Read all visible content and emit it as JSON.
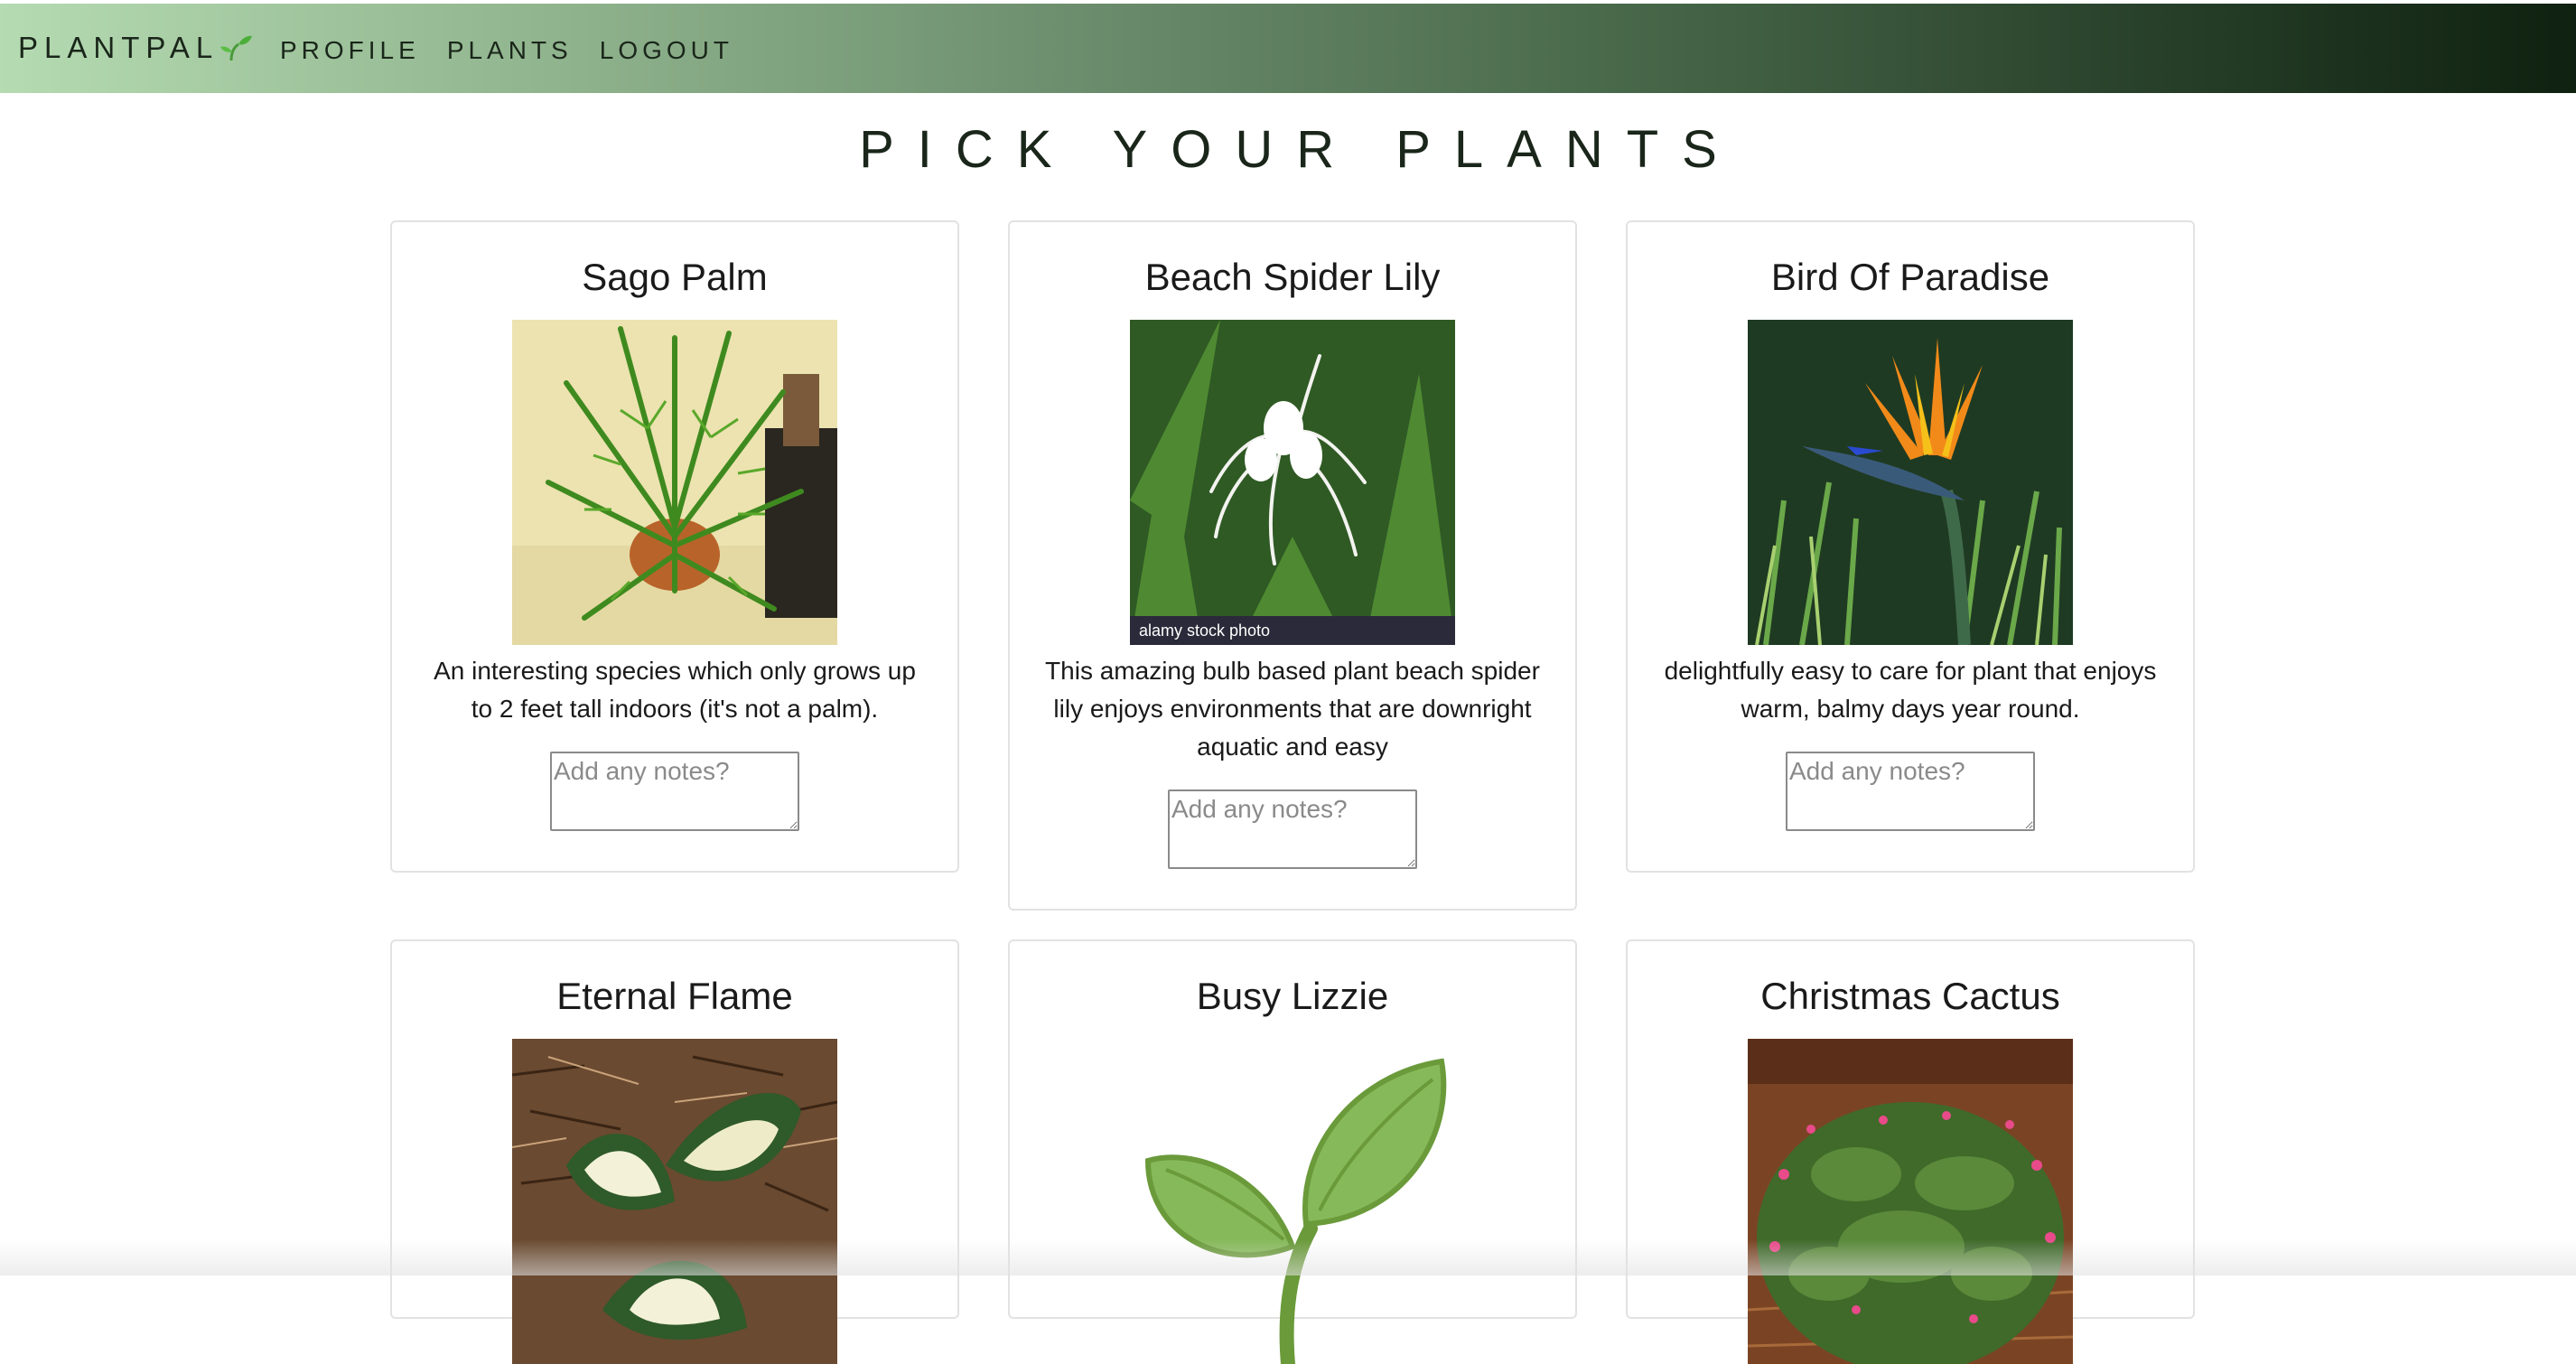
{
  "nav": {
    "brand": "PLANTPAL",
    "links": [
      "PROFILE",
      "PLANTS",
      "LOGOUT"
    ],
    "gradient_colors": [
      "#b5dbb2",
      "#0f2110"
    ]
  },
  "page": {
    "title": "PICK YOUR PLANTS"
  },
  "notes_placeholder": "Add any notes?",
  "plants": [
    {
      "name": "Sago Palm",
      "description": "An interesting species which only grows up to 2 feet tall indoors (it's not a palm).",
      "image": "sago-palm-photo"
    },
    {
      "name": "Beach Spider Lily",
      "description": "This amazing bulb based plant beach spider lily enjoys environments that are downright aquatic and easy",
      "image": "beach-spider-lily-photo",
      "watermark": "alamy stock photo"
    },
    {
      "name": "Bird Of Paradise",
      "description": "delightfully easy to care for plant that enjoys warm, balmy days year round.",
      "image": "bird-of-paradise-photo"
    },
    {
      "name": "Eternal Flame",
      "image": "eternal-flame-photo"
    },
    {
      "name": "Busy Lizzie",
      "image": "seedling-icon"
    },
    {
      "name": "Christmas Cactus",
      "image": "christmas-cactus-photo"
    }
  ]
}
